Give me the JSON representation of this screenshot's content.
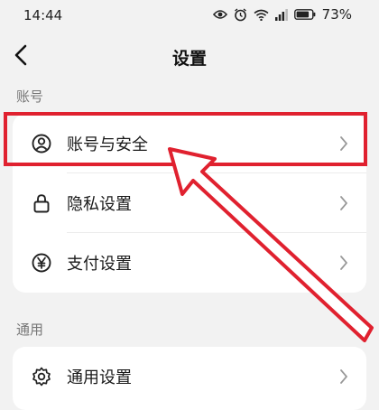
{
  "status_bar": {
    "time": "14:44",
    "battery": "73%",
    "icons": [
      "eye-icon",
      "alarm-icon",
      "wifi-icon",
      "signal-icon",
      "battery-icon"
    ]
  },
  "header": {
    "title": "设置",
    "back_icon": "back-arrow-icon"
  },
  "sections": [
    {
      "label": "账号",
      "items": [
        {
          "label": "账号与安全",
          "icon": "user-circle-icon"
        },
        {
          "label": "隐私设置",
          "icon": "lock-icon"
        },
        {
          "label": "支付设置",
          "icon": "yen-circle-icon"
        }
      ]
    },
    {
      "label": "通用",
      "items": [
        {
          "label": "通用设置",
          "icon": "gear-icon"
        }
      ]
    }
  ],
  "annotation": {
    "color": "#e0212f",
    "target": "账号与安全"
  }
}
